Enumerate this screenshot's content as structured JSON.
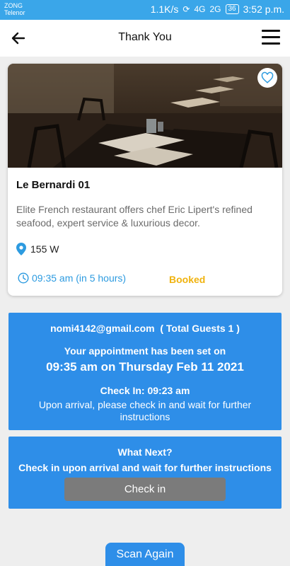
{
  "status_bar": {
    "carrier_1": "ZONG",
    "carrier_2": "Telenor",
    "speed": "1.1K/s",
    "network_1": "4G",
    "network_2": "2G",
    "battery": "36",
    "time": "3:52 p.m."
  },
  "header": {
    "title": "Thank You",
    "back_icon": "arrow-left-icon",
    "menu_icon": "hamburger-menu-icon"
  },
  "restaurant": {
    "name": "Le Bernardi 01",
    "description": "Elite French restaurant offers chef Eric Lipert's refined seafood, expert service & luxurious decor.",
    "address": "155 W",
    "time": "09:35 am (in 5 hours)",
    "status": "Booked",
    "favorite_icon": "heart-outline-icon"
  },
  "appointment": {
    "email": "nomi4142@gmail.com",
    "guests": "( Total Guests 1 )",
    "set_on_label": "Your appointment has been set on",
    "datetime": "09:35 am on Thursday Feb 11 2021",
    "check_in": "Check In: 09:23 am",
    "arrival_note": "Upon arrival, please check in and wait for further instructions"
  },
  "what_next": {
    "title": "What Next?",
    "instructions": "Check in upon arrival and wait for further instructions",
    "button_label": "Check in"
  },
  "scan_again_label": "Scan Again",
  "colors": {
    "primary": "#2e8ee8",
    "status_bar": "#3aa6e9",
    "booked": "#f0b30f",
    "disabled_button": "#7b7b7b"
  }
}
